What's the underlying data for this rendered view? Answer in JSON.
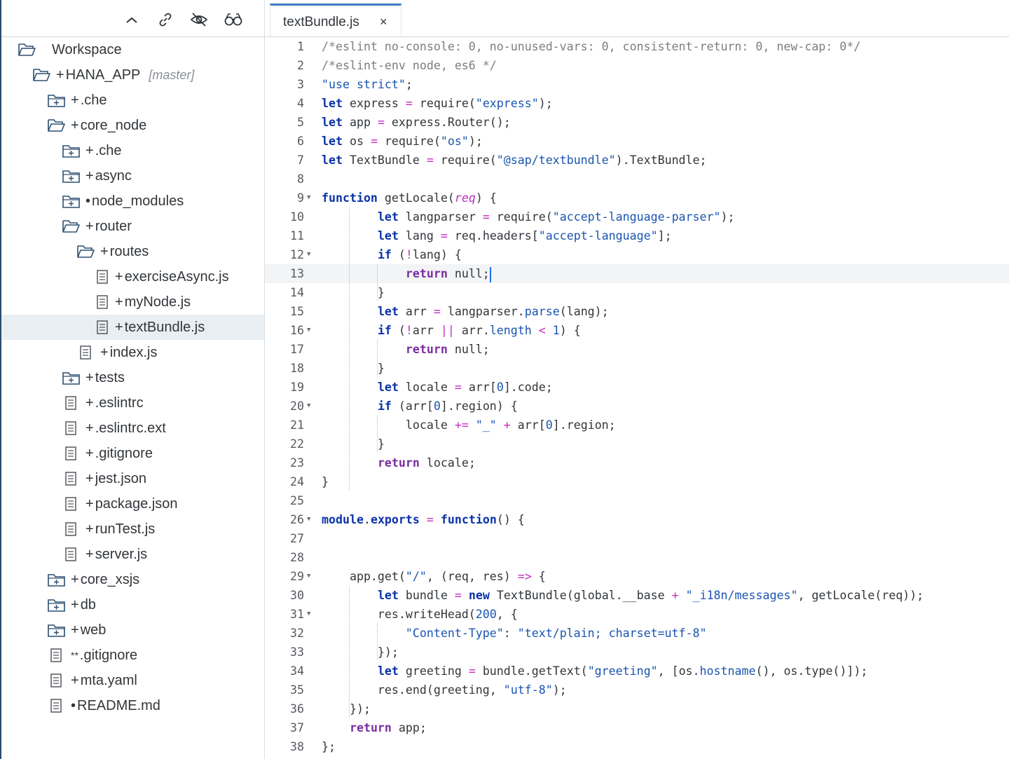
{
  "sidebar": {
    "toolbar": {
      "collapse_icon": "chevron-up-icon",
      "link_icon": "link-icon",
      "hide_icon": "eye-slash-icon",
      "search_icon": "binoculars-icon"
    },
    "tree": [
      {
        "prefix": "",
        "label": "Workspace",
        "type": "folder-open",
        "depth": 0
      },
      {
        "prefix": "+",
        "label": "HANA_APP",
        "branch": "[master]",
        "type": "folder-open",
        "depth": 1
      },
      {
        "prefix": "+",
        "label": ".che",
        "type": "folder-closed",
        "depth": 2
      },
      {
        "prefix": "+",
        "label": "core_node",
        "type": "folder-open",
        "depth": 2
      },
      {
        "prefix": "+",
        "label": ".che",
        "type": "folder-closed",
        "depth": 3
      },
      {
        "prefix": "+",
        "label": "async",
        "type": "folder-closed",
        "depth": 3
      },
      {
        "prefix": "•",
        "label": "node_modules",
        "type": "folder-closed",
        "depth": 3
      },
      {
        "prefix": "+",
        "label": "router",
        "type": "folder-open",
        "depth": 3
      },
      {
        "prefix": "+",
        "label": "routes",
        "type": "folder-open",
        "depth": 4
      },
      {
        "prefix": "+",
        "label": "exerciseAsync.js",
        "type": "file",
        "depth": 5
      },
      {
        "prefix": "+",
        "label": "myNode.js",
        "type": "file",
        "depth": 5
      },
      {
        "prefix": "+",
        "label": "textBundle.js",
        "type": "file",
        "depth": 5,
        "selected": true
      },
      {
        "prefix": "+",
        "label": "index.js",
        "type": "file",
        "depth": 4
      },
      {
        "prefix": "+",
        "label": "tests",
        "type": "folder-closed",
        "depth": 3
      },
      {
        "prefix": "+",
        "label": ".eslintrc",
        "type": "file",
        "depth": 3
      },
      {
        "prefix": "+",
        "label": ".eslintrc.ext",
        "type": "file",
        "depth": 3
      },
      {
        "prefix": "+",
        "label": ".gitignore",
        "type": "file",
        "depth": 3
      },
      {
        "prefix": "+",
        "label": "jest.json",
        "type": "file",
        "depth": 3
      },
      {
        "prefix": "+",
        "label": "package.json",
        "type": "file",
        "depth": 3
      },
      {
        "prefix": "+",
        "label": "runTest.js",
        "type": "file",
        "depth": 3
      },
      {
        "prefix": "+",
        "label": "server.js",
        "type": "file",
        "depth": 3
      },
      {
        "prefix": "+",
        "label": "core_xsjs",
        "type": "folder-closed",
        "depth": 2
      },
      {
        "prefix": "+",
        "label": "db",
        "type": "folder-closed",
        "depth": 2
      },
      {
        "prefix": "+",
        "label": "web",
        "type": "folder-closed",
        "depth": 2
      },
      {
        "prefix": "**",
        "label": ".gitignore",
        "type": "file",
        "depth": 2
      },
      {
        "prefix": "+",
        "label": "mta.yaml",
        "type": "file",
        "depth": 2
      },
      {
        "prefix": "•",
        "label": "README.md",
        "type": "file",
        "depth": 2
      }
    ]
  },
  "editor": {
    "tab": {
      "title": "textBundle.js",
      "close": "×"
    },
    "active_line": 13,
    "lines": [
      {
        "n": "1",
        "text": "/*eslint no-console: 0, no-unused-vars: 0, consistent-return: 0, new-cap: 0*/"
      },
      {
        "n": "2",
        "text": "/*eslint-env node, es6 */"
      },
      {
        "n": "3",
        "text": "\"use strict\";"
      },
      {
        "n": "4",
        "text": "let express = require(\"express\");"
      },
      {
        "n": "5",
        "text": "let app = express.Router();"
      },
      {
        "n": "6",
        "text": "let os = require(\"os\");"
      },
      {
        "n": "7",
        "text": "let TextBundle = require(\"@sap/textbundle\").TextBundle;"
      },
      {
        "n": "8",
        "text": ""
      },
      {
        "n": "9",
        "text": "function getLocale(req) {",
        "fold": true
      },
      {
        "n": "10",
        "text": "        let langparser = require(\"accept-language-parser\");"
      },
      {
        "n": "11",
        "text": "        let lang = req.headers[\"accept-language\"];"
      },
      {
        "n": "12",
        "text": "        if (!lang) {",
        "fold": true
      },
      {
        "n": "13",
        "text": "            return null;"
      },
      {
        "n": "14",
        "text": "        }"
      },
      {
        "n": "15",
        "text": "        let arr = langparser.parse(lang);"
      },
      {
        "n": "16",
        "text": "        if (!arr || arr.length < 1) {",
        "fold": true
      },
      {
        "n": "17",
        "text": "            return null;"
      },
      {
        "n": "18",
        "text": "        }"
      },
      {
        "n": "19",
        "text": "        let locale = arr[0].code;"
      },
      {
        "n": "20",
        "text": "        if (arr[0].region) {",
        "fold": true
      },
      {
        "n": "21",
        "text": "            locale += \"_\" + arr[0].region;"
      },
      {
        "n": "22",
        "text": "        }"
      },
      {
        "n": "23",
        "text": "        return locale;"
      },
      {
        "n": "24",
        "text": "}"
      },
      {
        "n": "25",
        "text": ""
      },
      {
        "n": "26",
        "text": "module.exports = function() {",
        "fold": true
      },
      {
        "n": "27",
        "text": ""
      },
      {
        "n": "28",
        "text": ""
      },
      {
        "n": "29",
        "text": "    app.get(\"/\", (req, res) => {",
        "fold": true
      },
      {
        "n": "30",
        "text": "        let bundle = new TextBundle(global.__base + \"_i18n/messages\", getLocale(req));"
      },
      {
        "n": "31",
        "text": "        res.writeHead(200, {",
        "fold": true
      },
      {
        "n": "32",
        "text": "            \"Content-Type\": \"text/plain; charset=utf-8\""
      },
      {
        "n": "33",
        "text": "        });"
      },
      {
        "n": "34",
        "text": "        let greeting = bundle.getText(\"greeting\", [os.hostname(), os.type()]);"
      },
      {
        "n": "35",
        "text": "        res.end(greeting, \"utf-8\");"
      },
      {
        "n": "36",
        "text": "    });"
      },
      {
        "n": "37",
        "text": "    return app;"
      },
      {
        "n": "38",
        "text": "};"
      }
    ]
  }
}
